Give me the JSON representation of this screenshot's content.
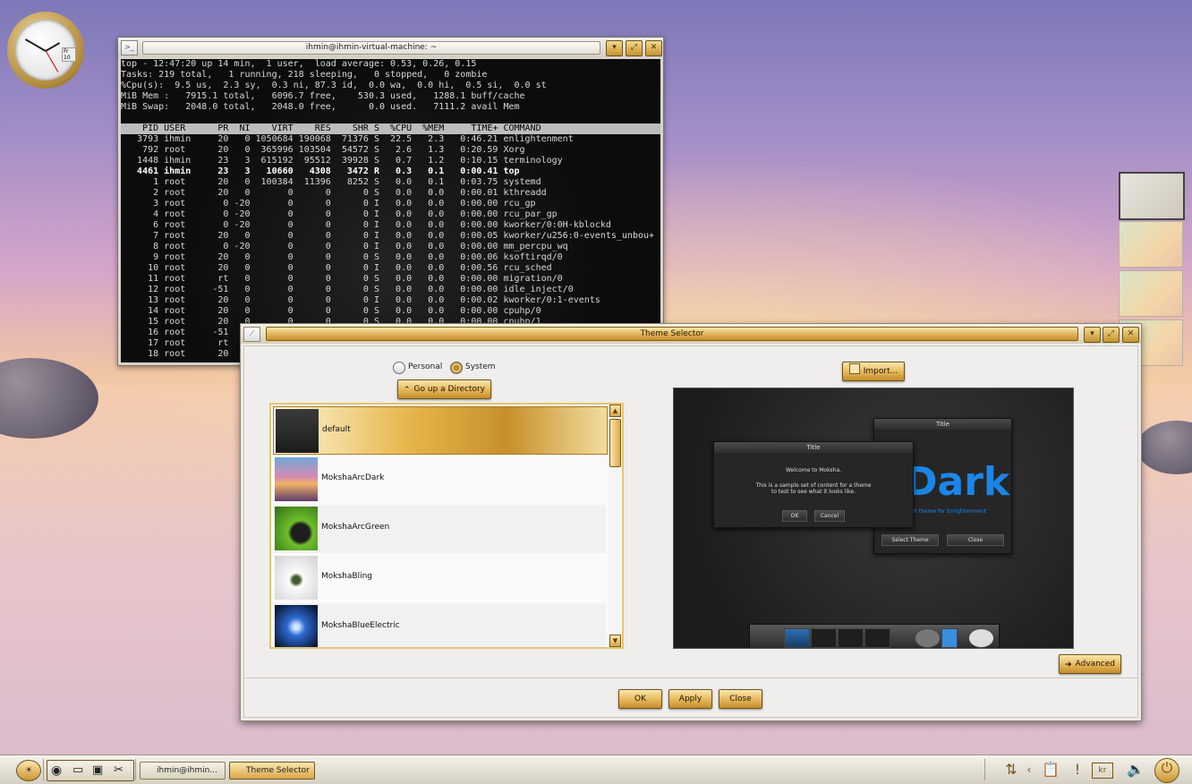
{
  "clock": {
    "date_badge": "Fr 10"
  },
  "terminal": {
    "title": "ihmin@ihmin-virtual-machine: ~",
    "summary": [
      "top - 12:47:20 up 14 min,  1 user,  load average: 0.53, 0.26, 0.15",
      "Tasks: 219 total,   1 running, 218 sleeping,   0 stopped,   0 zombie",
      "%Cpu(s):  9.5 us,  2.3 sy,  0.3 ni, 87.3 id,  0.0 wa,  0.0 hi,  0.5 si,  0.0 st",
      "MiB Mem :   7915.1 total,   6096.7 free,    530.3 used,   1288.1 buff/cache",
      "MiB Swap:   2048.0 total,   2048.0 free,      0.0 used.   7111.2 avail Mem"
    ],
    "header": "    PID USER      PR  NI    VIRT    RES    SHR S  %CPU  %MEM     TIME+ COMMAND",
    "rows": [
      "   3793 ihmin     20   0 1050684 190068  71376 S  22.5   2.3   0:46.21 enlightenment",
      "    792 root      20   0  365996 103504  54572 S   2.6   1.3   0:20.59 Xorg",
      "   1448 ihmin     23   3  615192  95512  39928 S   0.7   1.2   0:10.15 terminology",
      "   4461 ihmin     23   3   10660   4308   3472 R   0.3   0.1   0:00.41 top",
      "      1 root      20   0  100384  11396   8252 S   0.0   0.1   0:03.75 systemd",
      "      2 root      20   0       0      0      0 S   0.0   0.0   0:00.01 kthreadd",
      "      3 root       0 -20       0      0      0 I   0.0   0.0   0:00.00 rcu_gp",
      "      4 root       0 -20       0      0      0 I   0.0   0.0   0:00.00 rcu_par_gp",
      "      6 root       0 -20       0      0      0 I   0.0   0.0   0:00.00 kworker/0:0H-kblockd",
      "      7 root      20   0       0      0      0 I   0.0   0.0   0:00.05 kworker/u256:0-events_unbou+",
      "      8 root       0 -20       0      0      0 I   0.0   0.0   0:00.00 mm_percpu_wq",
      "      9 root      20   0       0      0      0 S   0.0   0.0   0:00.06 ksoftirqd/0",
      "     10 root      20   0       0      0      0 I   0.0   0.0   0:00.56 rcu_sched",
      "     11 root      rt   0       0      0      0 S   0.0   0.0   0:00.00 migration/0",
      "     12 root     -51   0       0      0      0 S   0.0   0.0   0:00.00 idle_inject/0",
      "     13 root      20   0       0      0      0 I   0.0   0.0   0:00.02 kworker/0:1-events",
      "     14 root      20   0       0      0      0 S   0.0   0.0   0:00.00 cpuhp/0",
      "     15 root      20   0       0      0      0 S   0.0   0.0   0:00.00 cpuhp/1",
      "     16 root     -51",
      "     17 root      rt",
      "     18 root      20"
    ],
    "bold_row_index": 3
  },
  "theme_selector": {
    "title": "Theme Selector",
    "radio_personal": "Personal",
    "radio_system": "System",
    "go_up": "Go up a Directory",
    "import": "Import...",
    "themes": [
      "default",
      "MokshaArcDark",
      "MokshaArcGreen",
      "MokshaBling",
      "MokshaBlueElectric"
    ],
    "selected_index": 0,
    "advanced": "Advanced",
    "ok": "OK",
    "apply": "Apply",
    "close": "Close",
    "preview": {
      "back_title": "Title",
      "front_title": "Title",
      "welcome": "Welcome to Moksha.",
      "sample": "This is a sample set of content for a theme to test to see what it looks like.",
      "ok": "OK",
      "cancel": "Cancel",
      "dark_word": "Dark",
      "dark_tagline": "ult theme for Enlightenment",
      "select_theme": "Select Theme",
      "close": "Close"
    }
  },
  "taskbar": {
    "tasks": [
      "ihmin@ihmin...",
      "Theme Selector"
    ],
    "tray_label": "kr"
  },
  "colors": {
    "gold": "#e2b55a",
    "accent_blue": "#1b86e8"
  }
}
